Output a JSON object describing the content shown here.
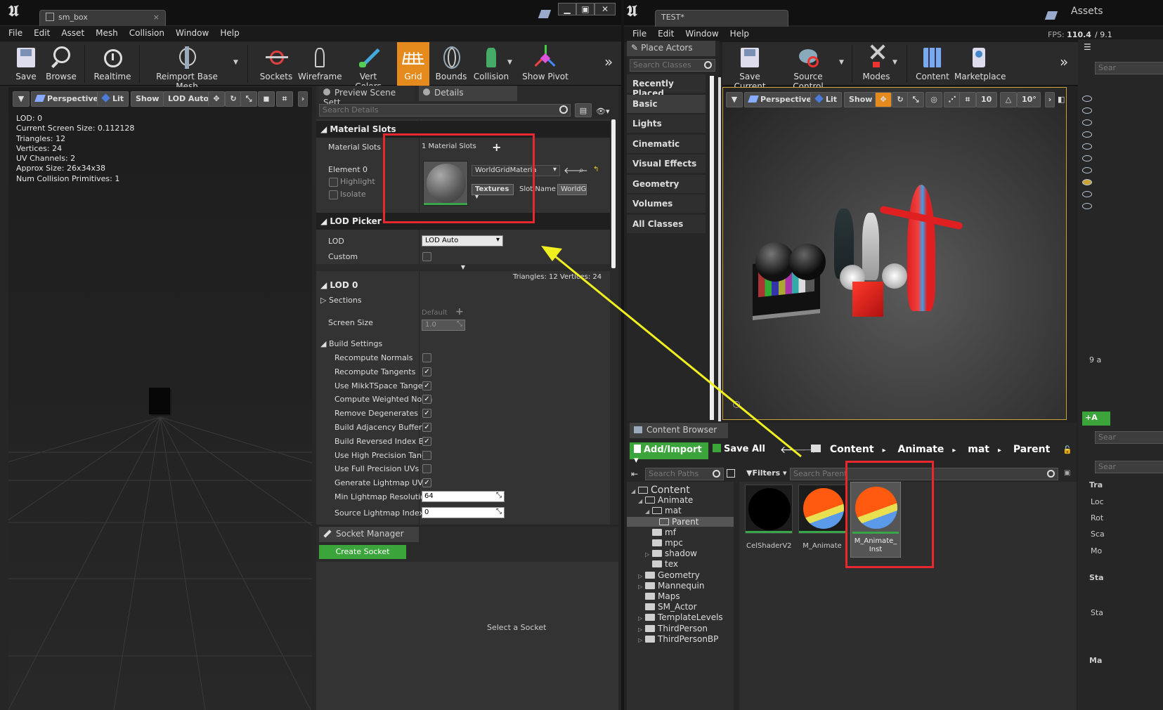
{
  "left": {
    "tab_title": "sm_box",
    "menu": [
      "File",
      "Edit",
      "Asset",
      "Mesh",
      "Collision",
      "Window",
      "Help"
    ],
    "toolbar": {
      "save": "Save",
      "browse": "Browse",
      "realtime": "Realtime",
      "reimport": "Reimport Base Mesh",
      "sockets": "Sockets",
      "wireframe": "Wireframe",
      "vertcolors": "Vert Colors",
      "grid": "Grid",
      "bounds": "Bounds",
      "collision": "Collision",
      "showpivot": "Show Pivot"
    },
    "viewport": {
      "perspective": "Perspective",
      "lit": "Lit",
      "show": "Show",
      "lod": "LOD Auto"
    },
    "stats": [
      "LOD:  0",
      "Current Screen Size:  0.112128",
      "Triangles:  12",
      "Vertices:  24",
      "UV Channels:  2",
      "Approx Size: 26x34x38",
      "Num Collision Primitives:  1"
    ]
  },
  "details": {
    "tabs": [
      "Preview Scene Sett",
      "Details"
    ],
    "search_placeholder": "Search Details",
    "material_slots_header": "Material Slots",
    "material_slots_label": "Material Slots",
    "material_slots_count": "1 Material Slots",
    "element_label": "Element 0",
    "highlight": "Highlight",
    "isolate": "Isolate",
    "material_name": "WorldGridMateria",
    "textures": "Textures",
    "slot_name_label": "Slot Name",
    "slot_name_value": "WorldG",
    "lod_picker_header": "LOD Picker",
    "lod_label": "LOD",
    "lod_value": "LOD Auto",
    "custom_label": "Custom",
    "tri_verts": "Triangles: 12    Vertices: 24",
    "lod0_header": "LOD 0",
    "sections": "Sections",
    "screen_size": "Screen Size",
    "default": "Default",
    "screen_size_value": "1.0",
    "build_settings": "Build Settings",
    "build_rows": [
      {
        "label": "Recompute Normals",
        "checked": false
      },
      {
        "label": "Recompute Tangents",
        "checked": true
      },
      {
        "label": "Use MikkTSpace Tangen",
        "checked": true
      },
      {
        "label": "Compute Weighted Norm",
        "checked": true
      },
      {
        "label": "Remove Degenerates",
        "checked": true
      },
      {
        "label": "Build Adjacency Buffer",
        "checked": true
      },
      {
        "label": "Build Reversed Index Buf",
        "checked": true
      },
      {
        "label": "Use High Precision Tang",
        "checked": false
      },
      {
        "label": "Use Full Precision UVs",
        "checked": false
      },
      {
        "label": "Generate Lightmap UVs",
        "checked": true
      }
    ],
    "min_lightmap_label": "Min Lightmap Resolution",
    "min_lightmap_value": "64",
    "src_lightmap_label": "Source Lightmap Index",
    "src_lightmap_value": "0"
  },
  "socket": {
    "tab": "Socket Manager",
    "create": "Create Socket",
    "empty": "Select a Socket"
  },
  "editor": {
    "tab_title": "TEST*",
    "assets_label": "Assets",
    "menu": [
      "File",
      "Edit",
      "Window",
      "Help"
    ],
    "fps": "FPS: 110.4",
    "fps_extra": "/ 9.1",
    "place_actors": "Place Actors",
    "search_classes": "Search Classes",
    "classes": [
      "Recently Placed",
      "Basic",
      "Lights",
      "Cinematic",
      "Visual Effects",
      "Geometry",
      "Volumes",
      "All Classes"
    ],
    "toolbar": {
      "save": "Save Current",
      "source": "Source Control",
      "modes": "Modes",
      "content": "Content",
      "marketplace": "Marketplace"
    },
    "viewport": {
      "perspective": "Perspective",
      "lit": "Lit",
      "show": "Show",
      "grid": "10",
      "angle": "10°"
    }
  },
  "content_browser": {
    "tab": "Content Browser",
    "add_import": "Add/Import",
    "save_all": "Save All",
    "breadcrumb": [
      "Content",
      "Animate",
      "mat",
      "Parent"
    ],
    "search_paths": "Search Paths",
    "filters": "Filters",
    "search_parent": "Search Parent",
    "tree": [
      {
        "label": "Content",
        "depth": 0,
        "expanded": true
      },
      {
        "label": "Animate",
        "depth": 1,
        "expanded": true
      },
      {
        "label": "mat",
        "depth": 2,
        "expanded": true
      },
      {
        "label": "Parent",
        "depth": 3,
        "expanded": false,
        "selected": true
      },
      {
        "label": "mf",
        "depth": 2
      },
      {
        "label": "mpc",
        "depth": 2
      },
      {
        "label": "shadow",
        "depth": 2,
        "collapsed": true
      },
      {
        "label": "tex",
        "depth": 2
      },
      {
        "label": "Geometry",
        "depth": 1,
        "collapsed": true
      },
      {
        "label": "Mannequin",
        "depth": 1,
        "collapsed": true
      },
      {
        "label": "Maps",
        "depth": 1
      },
      {
        "label": "SM_Actor",
        "depth": 1
      },
      {
        "label": "TemplateLevels",
        "depth": 1,
        "collapsed": true
      },
      {
        "label": "ThirdPerson",
        "depth": 1,
        "collapsed": true
      },
      {
        "label": "ThirdPersonBP",
        "depth": 1,
        "collapsed": true
      }
    ],
    "assets": [
      "CelShaderV2",
      "M_Animate",
      "M_Animate_\nInst"
    ]
  },
  "right_strip": {
    "items_count": "9 a",
    "search": "Sear",
    "labels": [
      "Tra",
      "Loc",
      "Rot",
      "Sca",
      "Mo",
      "Sta",
      "Sta",
      "Ma"
    ]
  },
  "colors": {
    "accent": "#e58a1c",
    "highlight_box": "#e8282e",
    "arrow": "#f0f020",
    "green": "#3aa64a"
  }
}
